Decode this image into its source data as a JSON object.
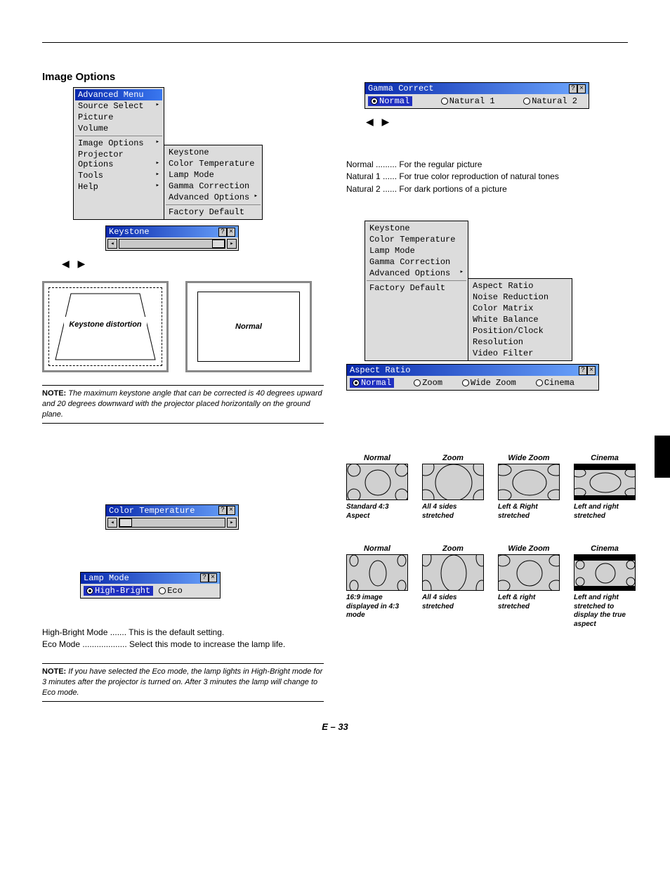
{
  "section_title": "Image Options",
  "advanced_menu": {
    "title": "Advanced Menu",
    "items": [
      "Source Select",
      "Picture",
      "Volume",
      "Image Options",
      "Projector Options",
      "Tools",
      "Help"
    ]
  },
  "image_options_submenu": {
    "items": [
      "Keystone",
      "Color Temperature",
      "Lamp Mode",
      "Gamma Correction",
      "Advanced Options",
      "Factory Default"
    ]
  },
  "keystone_dialog": {
    "title": "Keystone"
  },
  "keystone_diagrams": {
    "distortion": "Keystone distortion",
    "normal": "Normal"
  },
  "note_keystone": "The maximum keystone angle that can be corrected is 40 degrees upward and 20 degrees downward with the projector placed horizontally on the ground plane.",
  "note_label": "NOTE:",
  "color_temp_dialog": {
    "title": "Color Temperature"
  },
  "lamp_mode_dialog": {
    "title": "Lamp Mode",
    "options": [
      "High-Bright",
      "Eco"
    ]
  },
  "lamp_mode_desc": [
    "High-Bright Mode ....... This is the default setting.",
    "Eco Mode ................... Select this mode to increase the lamp life."
  ],
  "note_eco": "If you have selected the Eco mode, the lamp lights in High-Bright mode for 3 minutes after the projector is turned on. After 3 minutes the lamp will change to Eco mode.",
  "gamma_dialog": {
    "title": "Gamma Correct",
    "options": [
      "Normal",
      "Natural 1",
      "Natural 2"
    ]
  },
  "gamma_desc": [
    "Normal ......... For the regular picture",
    "Natural 1 ...... For true color reproduction of natural tones",
    "Natural 2 ...... For dark portions of a picture"
  ],
  "io_submenu_col2_left": {
    "items": [
      "Keystone",
      "Color Temperature",
      "Lamp Mode",
      "Gamma Correction",
      "Advanced Options",
      "Factory Default"
    ]
  },
  "advanced_options_submenu": {
    "items": [
      "Aspect Ratio",
      "Noise Reduction",
      "Color Matrix",
      "White Balance",
      "Position/Clock",
      "Resolution",
      "Video Filter"
    ]
  },
  "aspect_dialog": {
    "title": "Aspect Ratio",
    "options": [
      "Normal",
      "Zoom",
      "Wide Zoom",
      "Cinema"
    ]
  },
  "aspect_row1": {
    "headers": [
      "Normal",
      "Zoom",
      "Wide Zoom",
      "Cinema"
    ],
    "subs": [
      "Standard 4:3 Aspect",
      "All 4 sides stretched",
      "Left & Right stretched",
      "Left and right stretched"
    ]
  },
  "aspect_row2": {
    "headers": [
      "Normal",
      "Zoom",
      "Wide Zoom",
      "Cinema"
    ],
    "subs": [
      "16:9 image displayed in 4:3 mode",
      "All 4 sides stretched",
      "Left & right stretched",
      "Left and right stretched to display the true aspect"
    ]
  },
  "page_number": "E – 33",
  "help_x": {
    "help": "?",
    "close": "×"
  },
  "arrow_glyphs": {
    "left": "◀",
    "right": "▶"
  }
}
